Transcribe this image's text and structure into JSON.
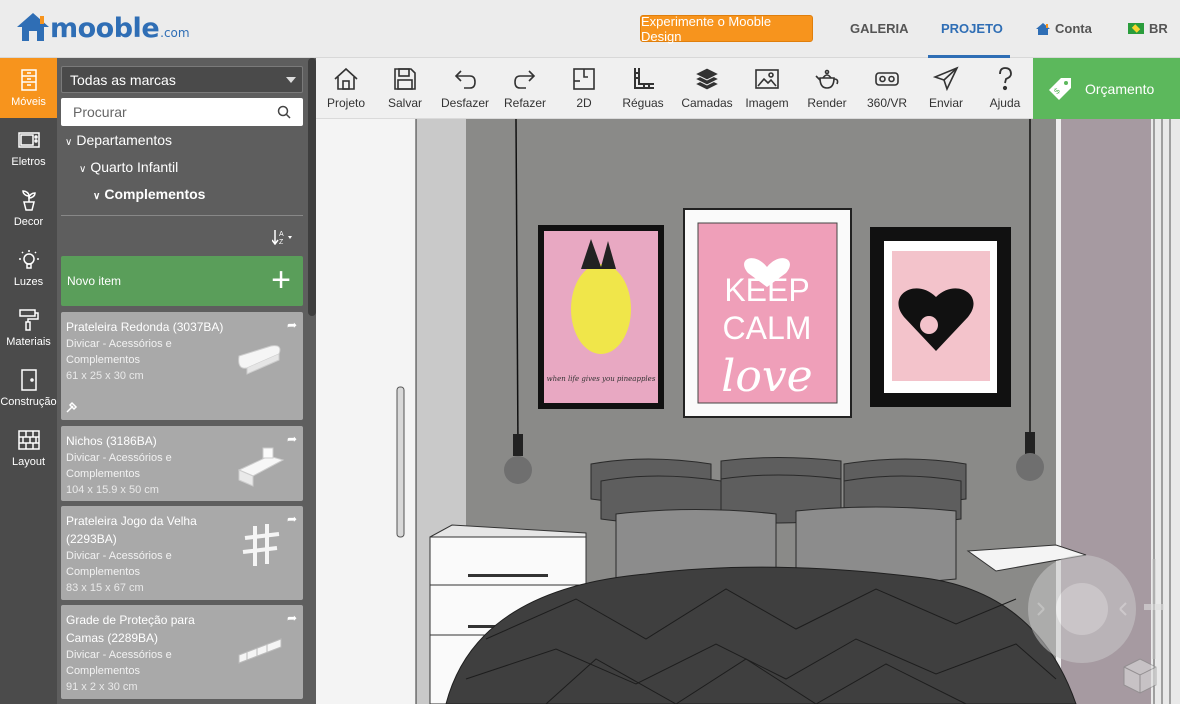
{
  "header": {
    "logo_text": "mooble",
    "logo_suffix": ".com",
    "try_button": "Experimente o Mooble Design",
    "nav_galeria": "GALERIA",
    "nav_projeto": "PROJETO",
    "nav_conta": "Conta",
    "nav_lang": "BR"
  },
  "categories": [
    {
      "label": "Móveis",
      "icon": "furniture-icon"
    },
    {
      "label": "Eletros",
      "icon": "microwave-icon"
    },
    {
      "label": "Decor",
      "icon": "plant-icon"
    },
    {
      "label": "Luzes",
      "icon": "bulb-icon"
    },
    {
      "label": "Materiais",
      "icon": "paint-roller-icon"
    },
    {
      "label": "Construção",
      "icon": "door-icon"
    },
    {
      "label": "Layout",
      "icon": "brick-wall-icon"
    }
  ],
  "panel": {
    "brand_select": "Todas as marcas",
    "search_placeholder": "Procurar",
    "tree": [
      "Departamentos",
      "Quarto Infantil",
      "Complementos"
    ],
    "new_item": "Novo item",
    "items": [
      {
        "title": "Prateleira Redonda (3037BA)",
        "brand": "Divicar - Acessórios e Complementos",
        "dims": "61 x 25 x 30 cm"
      },
      {
        "title": "Nichos (3186BA)",
        "brand": "Divicar - Acessórios e Complementos",
        "dims": "104 x 15.9 x 50 cm"
      },
      {
        "title": "Prateleira Jogo da Velha (2293BA)",
        "brand": "Divicar - Acessórios e Complementos",
        "dims": "83 x 15 x 67 cm"
      },
      {
        "title": "Grade de Proteção para Camas (2289BA)",
        "brand": "Divicar - Acessórios e Complementos",
        "dims": "91 x 2 x 30 cm"
      }
    ]
  },
  "toolbar": [
    {
      "label": "Projeto",
      "icon": "home-icon"
    },
    {
      "label": "Salvar",
      "icon": "save-icon"
    },
    {
      "label": "Desfazer",
      "icon": "undo-icon"
    },
    {
      "label": "Refazer",
      "icon": "redo-icon"
    },
    {
      "label": "2D",
      "icon": "floorplan-icon"
    },
    {
      "label": "Réguas",
      "icon": "ruler-icon"
    },
    {
      "label": "Camadas",
      "icon": "layers-icon"
    },
    {
      "label": "Imagem",
      "icon": "image-icon"
    },
    {
      "label": "Render",
      "icon": "teapot-icon"
    },
    {
      "label": "360/VR",
      "icon": "vr-icon"
    },
    {
      "label": "Enviar",
      "icon": "send-icon"
    },
    {
      "label": "Ajuda",
      "icon": "help-icon"
    }
  ],
  "quote_button": "Orçamento",
  "artwork": {
    "poster_line1": "KEEP",
    "poster_line2": "CALM",
    "poster_line3": "love",
    "pineapple_caption": "when life gives you pineapples"
  },
  "colors": {
    "accent_orange": "#f7941d",
    "brand_blue": "#2f6eb5",
    "green": "#5cb85c"
  }
}
